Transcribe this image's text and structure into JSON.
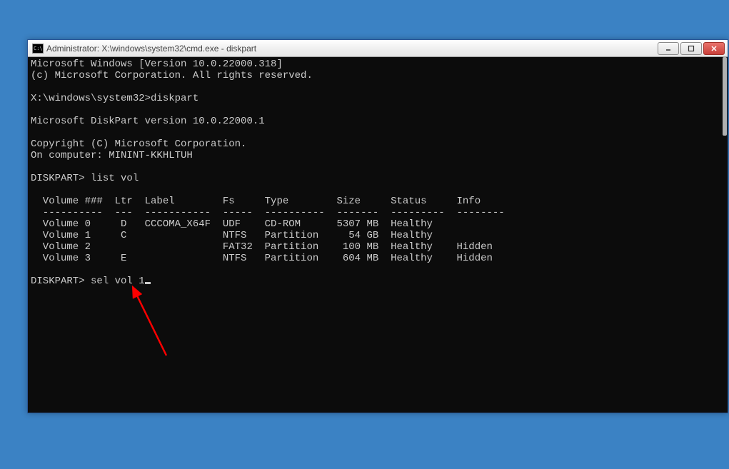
{
  "window": {
    "title": "Administrator: X:\\windows\\system32\\cmd.exe - diskpart"
  },
  "terminal": {
    "line1": "Microsoft Windows [Version 10.0.22000.318]",
    "line2": "(c) Microsoft Corporation. All rights reserved.",
    "blank1": "",
    "prompt1": "X:\\windows\\system32>diskpart",
    "blank2": "",
    "line3": "Microsoft DiskPart version 10.0.22000.1",
    "blank3": "",
    "line4": "Copyright (C) Microsoft Corporation.",
    "line5": "On computer: MININT-KKHLTUH",
    "blank4": "",
    "prompt2": "DISKPART> list vol",
    "blank5": "",
    "header": "  Volume ###  Ltr  Label        Fs     Type        Size     Status     Info",
    "divider": "  ----------  ---  -----------  -----  ----------  -------  ---------  --------",
    "row0": "  Volume 0     D   CCCOMA_X64F  UDF    CD-ROM      5307 MB  Healthy",
    "row1": "  Volume 1     C                NTFS   Partition     54 GB  Healthy",
    "row2": "  Volume 2                      FAT32  Partition    100 MB  Healthy    Hidden",
    "row3": "  Volume 3     E                NTFS   Partition    604 MB  Healthy    Hidden",
    "blank6": "",
    "prompt3_prefix": "DISKPART> ",
    "prompt3_input": "sel vol 1"
  }
}
